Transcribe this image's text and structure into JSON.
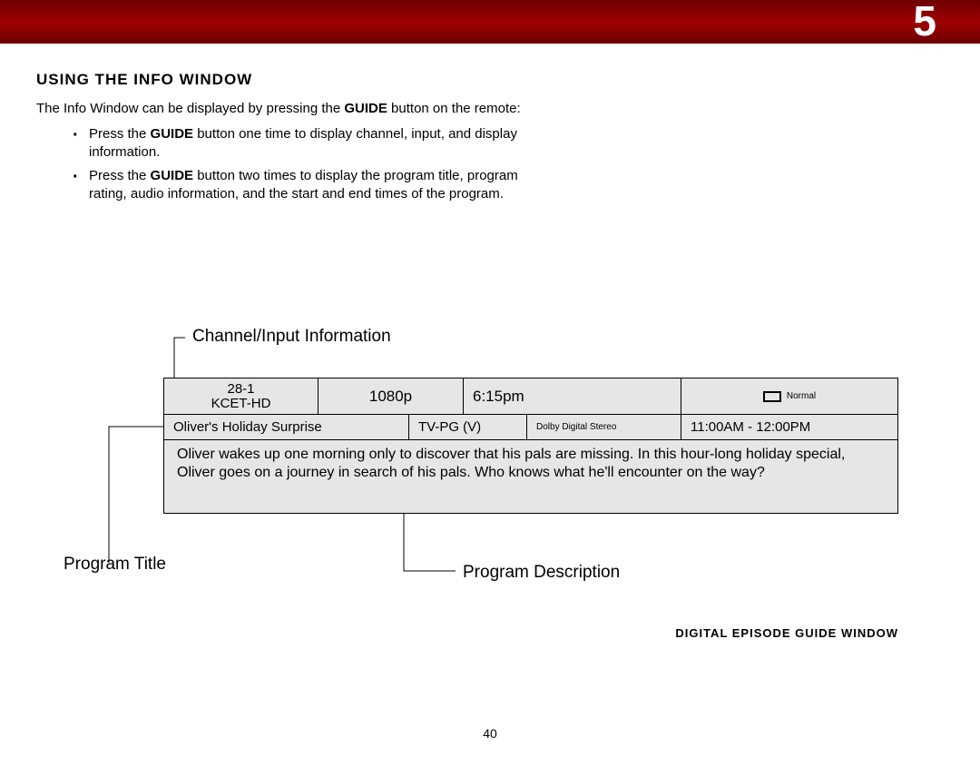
{
  "header": {
    "number": "5"
  },
  "section": {
    "title": "USING THE INFO WINDOW"
  },
  "intro": {
    "pre": "The Info Window can be displayed by pressing the ",
    "bold": "GUIDE",
    "post": " button on the remote:"
  },
  "bullets": [
    {
      "pre": "Press the ",
      "bold": "GUIDE",
      "post": " button one time to display channel, input, and display information."
    },
    {
      "pre": "Press the ",
      "bold": "GUIDE",
      "post": " button two times to display the program title, program rating, audio information, and the start and end times of the program."
    }
  ],
  "labels": {
    "channel": "Channel/Input Information",
    "program_title": "Program Title",
    "program_desc": "Program Description"
  },
  "info": {
    "channel_num": "28-1",
    "channel_name": "KCET-HD",
    "resolution": "1080p",
    "clock": "6:15pm",
    "display_mode": "Normal",
    "title": "Oliver's Holiday Surprise",
    "rating": "TV-PG (V)",
    "audio": "Dolby Digital Stereo",
    "airtime": "11:00AM - 12:00PM",
    "description": "Oliver wakes up one morning only to discover that his pals are missing. In this hour-long holiday special, Oliver goes on a journey in search of his pals. Who knows what he'll encounter on the way?"
  },
  "caption": "DIGITAL EPISODE GUIDE WINDOW",
  "page_number": "40"
}
